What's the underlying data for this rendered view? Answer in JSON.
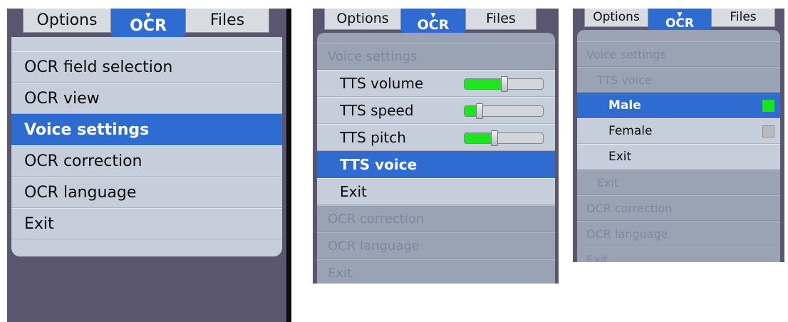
{
  "tabs": {
    "options": "Options",
    "ocr": "OCR",
    "files": "Files",
    "ocr_marker": "▼"
  },
  "screen1": {
    "items": [
      "OCR field selection",
      "OCR view",
      "Voice settings",
      "OCR correction",
      "OCR language",
      "Exit"
    ],
    "selected": "Voice settings"
  },
  "screen2": {
    "header": "Voice settings",
    "sliders": [
      {
        "label": "TTS volume",
        "value": 0.5
      },
      {
        "label": "TTS speed",
        "value": 0.18
      },
      {
        "label": "TTS pitch",
        "value": 0.37
      }
    ],
    "tts_voice": "TTS voice",
    "exit": "Exit",
    "below": [
      "OCR correction",
      "OCR language",
      "Exit"
    ]
  },
  "screen3": {
    "header": "Voice settings",
    "subheader": "TTS voice",
    "options": [
      {
        "label": "Male",
        "checked": true
      },
      {
        "label": "Female",
        "checked": false
      }
    ],
    "exit": "Exit",
    "outer_exit": "Exit",
    "below": [
      "OCR correction",
      "OCR language",
      "Exit"
    ]
  },
  "colors": {
    "accent": "#2f6cd1",
    "slider_fill": "#1ee61e",
    "check_on": "#17e517",
    "background": "#5a5670"
  }
}
